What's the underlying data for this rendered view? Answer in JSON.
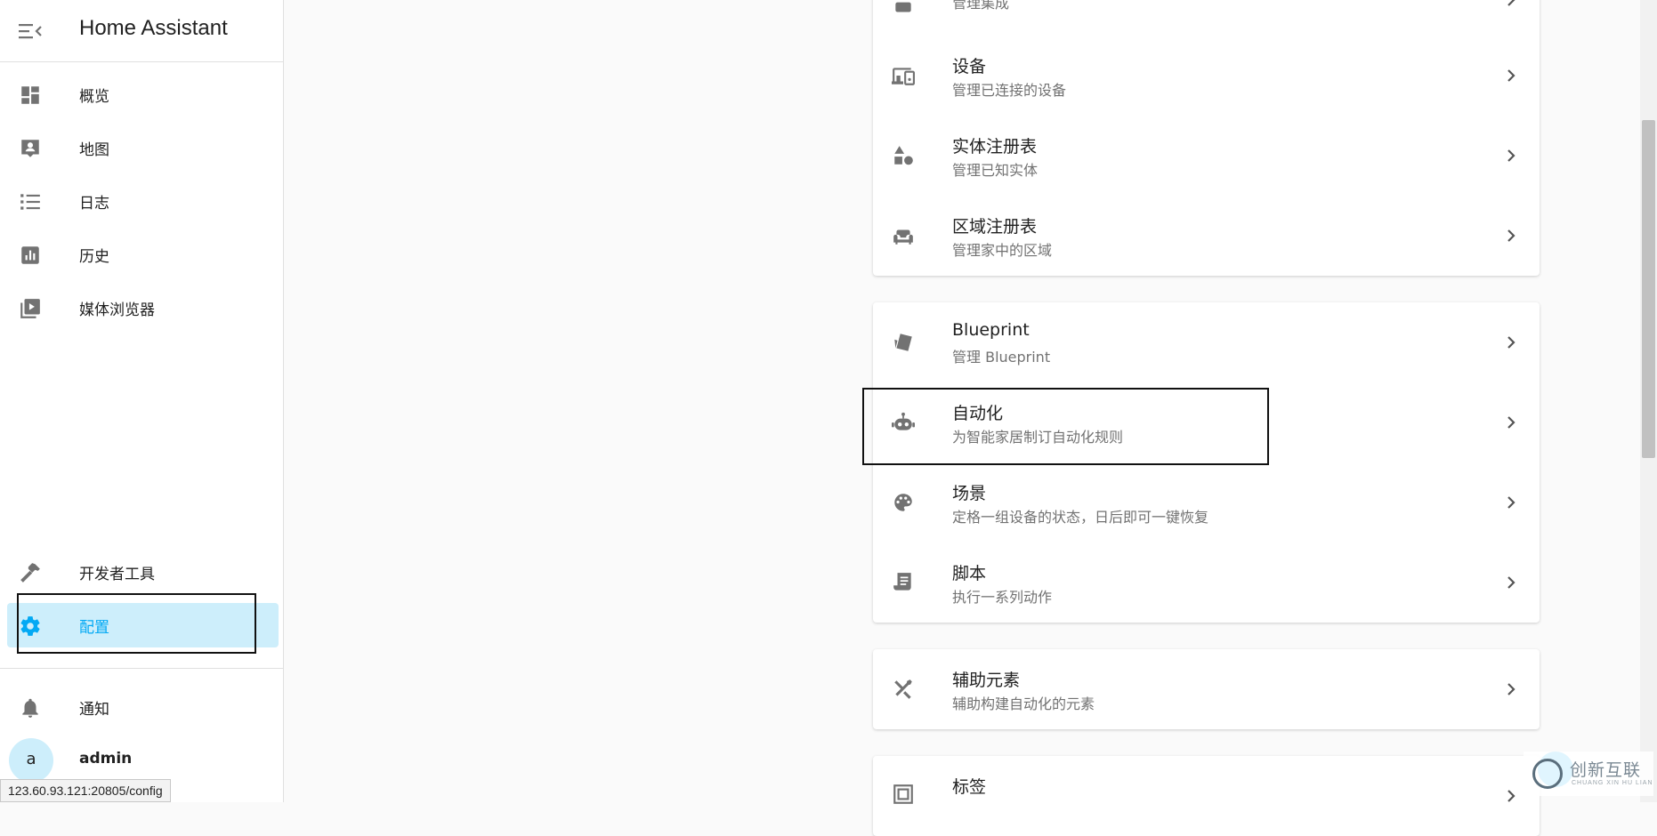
{
  "sidebar": {
    "title": "Home Assistant",
    "items": [
      {
        "label": "概览",
        "icon": "dashboard-icon"
      },
      {
        "label": "地图",
        "icon": "map-account-icon"
      },
      {
        "label": "日志",
        "icon": "logbook-list-icon"
      },
      {
        "label": "历史",
        "icon": "history-chart-icon"
      },
      {
        "label": "媒体浏览器",
        "icon": "media-browser-icon"
      }
    ],
    "bottom_items": [
      {
        "label": "开发者工具",
        "icon": "hammer-icon"
      },
      {
        "label": "配置",
        "icon": "gear-icon",
        "active": true
      }
    ],
    "notifications_label": "通知",
    "user": {
      "avatar_letter": "a",
      "name": "admin"
    }
  },
  "status_url": "123.60.93.121:20805/config",
  "cards": [
    {
      "rows": [
        {
          "title": "",
          "subtitle": "管理集成",
          "icon": "integrations-icon"
        },
        {
          "title": "设备",
          "subtitle": "管理已连接的设备",
          "icon": "devices-icon"
        },
        {
          "title": "实体注册表",
          "subtitle": "管理已知实体",
          "icon": "shapes-icon"
        },
        {
          "title": "区域注册表",
          "subtitle": "管理家中的区域",
          "icon": "sofa-icon"
        }
      ]
    },
    {
      "rows": [
        {
          "title": "Blueprint",
          "subtitle": "管理 Blueprint",
          "icon": "blueprint-icon"
        },
        {
          "title": "自动化",
          "subtitle": "为智能家居制订自动化规则",
          "icon": "robot-icon"
        },
        {
          "title": "场景",
          "subtitle": "定格一组设备的状态，日后即可一键恢复",
          "icon": "palette-icon"
        },
        {
          "title": "脚本",
          "subtitle": "执行一系列动作",
          "icon": "script-icon"
        }
      ]
    },
    {
      "rows": [
        {
          "title": "辅助元素",
          "subtitle": "辅助构建自动化的元素",
          "icon": "tools-icon"
        }
      ]
    },
    {
      "rows": [
        {
          "title": "标签",
          "subtitle": "",
          "icon": "tag-icon"
        }
      ]
    }
  ],
  "watermark": {
    "text": "创新互联",
    "sub": "CHUANG XIN HU LIAN"
  },
  "colors": {
    "accent": "#03a9f4",
    "active_bg": "#cdeefb",
    "icon": "#727272"
  }
}
